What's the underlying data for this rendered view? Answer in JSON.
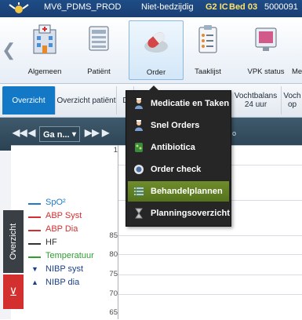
{
  "titlebar": {
    "app": "MV6_PDMS_PROD",
    "status": "Niet-bedzijdig",
    "unit": "G2 IC",
    "bed": "Bed 03",
    "id": "5000091"
  },
  "ribbon": {
    "tools": [
      {
        "label": "Algemeen",
        "icon": "hospital-icon"
      },
      {
        "label": "Patiënt",
        "icon": "patient-bed-icon"
      },
      {
        "label": "Order",
        "icon": "pill-icon"
      },
      {
        "label": "Taaklijst",
        "icon": "clipboard-checklist-icon"
      },
      {
        "label": "VPK status",
        "icon": "monitor-icon"
      },
      {
        "label": "Me",
        "icon": "more-icon"
      }
    ]
  },
  "tabs": [
    {
      "label": "Overzicht"
    },
    {
      "label": "Overzicht patiënt"
    },
    {
      "label": "D"
    },
    {
      "label": "Vochtbalans 24 uur"
    },
    {
      "label": "Voch op"
    }
  ],
  "timeline": {
    "go_label": "Ga n...",
    "o_label": "o"
  },
  "side_tab": {
    "label": "Overzicht",
    "button_glyph": "⊻"
  },
  "legend": [
    {
      "label": "SpO²",
      "color": "#1f78c8",
      "marker": "line"
    },
    {
      "label": "ABP Syst",
      "color": "#d32f2f",
      "marker": "line"
    },
    {
      "label": "ABP Dia",
      "color": "#d32f2f",
      "marker": "line"
    },
    {
      "label": "HF",
      "color": "#333333",
      "marker": "line"
    },
    {
      "label": "Temperatuur",
      "color": "#2e9e2e",
      "marker": "line"
    },
    {
      "label": "NIBP syst",
      "color": "#1d3f8a",
      "marker": "▼"
    },
    {
      "label": "NIBP dia",
      "color": "#1d3f8a",
      "marker": "▲"
    }
  ],
  "y_axis": {
    "ticks": [
      "1",
      "85",
      "80",
      "75",
      "70",
      "65"
    ]
  },
  "menu": {
    "items": [
      {
        "label": "Medicatie en Taken",
        "icon": "nurse-icon",
        "highlighted": false
      },
      {
        "label": "Snel Orders",
        "icon": "nurse-icon",
        "highlighted": false
      },
      {
        "label": "Antibiotica",
        "icon": "bacteria-icon",
        "highlighted": false
      },
      {
        "label": "Order check",
        "icon": "check-badge-icon",
        "highlighted": false
      },
      {
        "label": "Behandelplannen",
        "icon": "list-icon",
        "highlighted": true
      },
      {
        "label": "Planningsoverzicht",
        "icon": "hourglass-icon",
        "highlighted": false
      }
    ]
  },
  "colors": {
    "titlebar": "#1e4c86",
    "tab_active": "#1379c6",
    "menu_bg": "#262626",
    "menu_highlight": "#6f8d2c",
    "timeline": "#3f5a6d"
  }
}
